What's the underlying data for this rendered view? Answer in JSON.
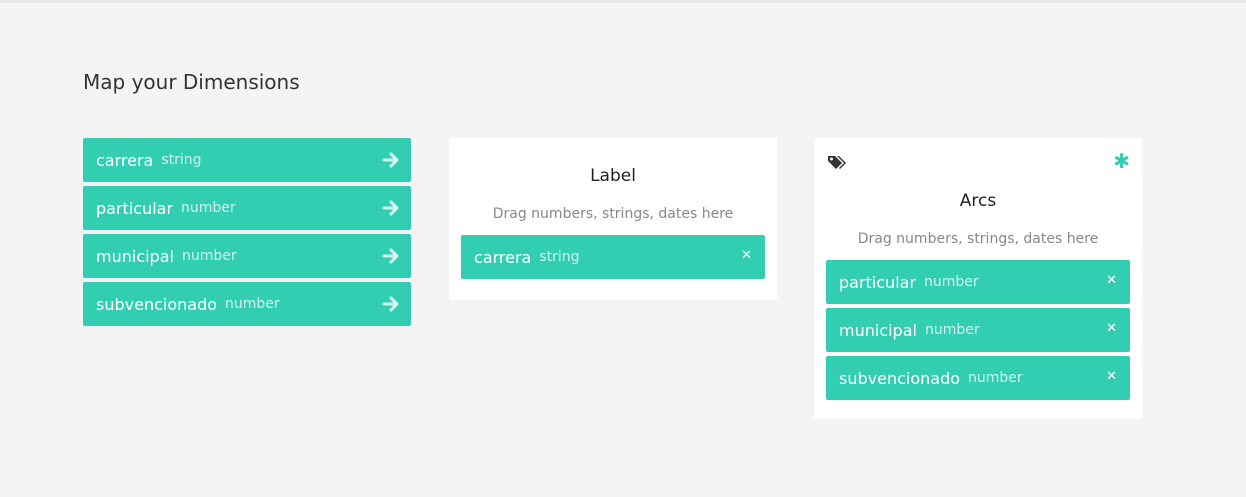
{
  "page": {
    "title": "Map your Dimensions"
  },
  "dimensions": [
    {
      "name": "carrera",
      "type": "string"
    },
    {
      "name": "particular",
      "type": "number"
    },
    {
      "name": "municipal",
      "type": "number"
    },
    {
      "name": "subvencionado",
      "type": "number"
    }
  ],
  "label_box": {
    "title": "Label",
    "hint": "Drag numbers, strings, dates here",
    "items": [
      {
        "name": "carrera",
        "type": "string"
      }
    ]
  },
  "arcs_box": {
    "title": "Arcs",
    "hint": "Drag numbers, strings, dates here",
    "required_marker": "✱",
    "items": [
      {
        "name": "particular",
        "type": "number"
      },
      {
        "name": "municipal",
        "type": "number"
      },
      {
        "name": "subvencionado",
        "type": "number"
      }
    ]
  },
  "icons": {
    "arrow": "arrow-right-icon",
    "remove": "close-icon",
    "tag": "tags-icon"
  },
  "colors": {
    "accent": "#32ceb2",
    "background": "#f4f4f4"
  },
  "close_glyph": "✕"
}
